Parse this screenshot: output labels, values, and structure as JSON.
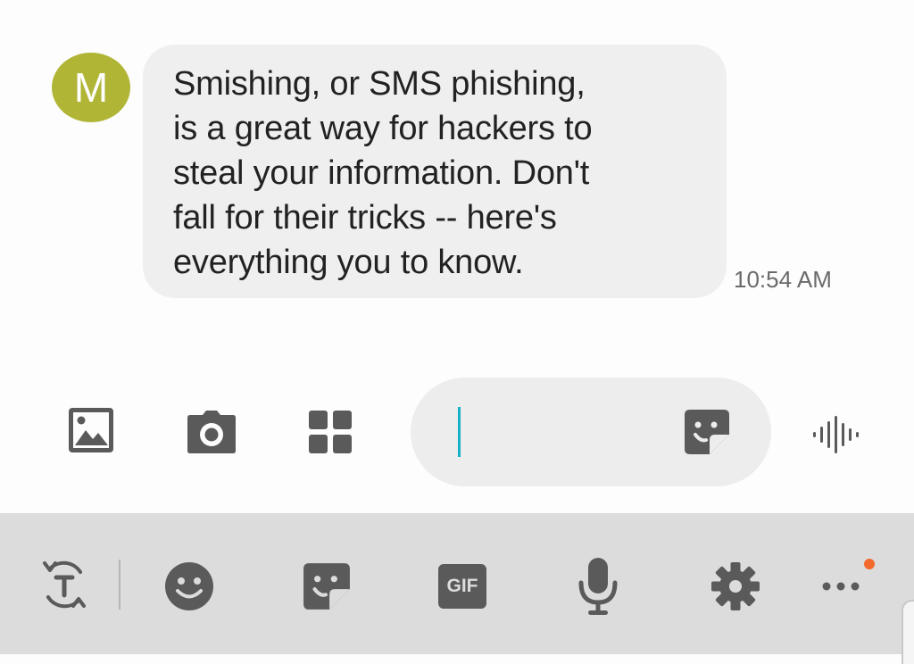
{
  "conversation": {
    "sender_initial": "M",
    "message_lines": [
      "Smishing, or SMS phishing,",
      "is a great way for hackers to",
      "steal your information. Don't",
      "fall for their tricks -- here's",
      "everything you to know."
    ],
    "timestamp": "10:54 AM"
  },
  "composer": {
    "input_value": "",
    "buttons": {
      "gallery": "image-icon",
      "camera": "camera-icon",
      "apps": "grid-icon",
      "sticker": "sticker-icon",
      "voice": "voice-wave-icon"
    }
  },
  "keyboard_toolbar": {
    "gif_label": "GIF",
    "icons": [
      "translate-icon",
      "emoji-icon",
      "sticker-icon",
      "gif-icon",
      "microphone-icon",
      "settings-icon",
      "more-icon"
    ],
    "notification_dot_color": "#f26a2c"
  },
  "colors": {
    "avatar": "#b1b536",
    "bubble": "#efefef",
    "cursor": "#16b2c8",
    "toolbar": "#dcdcdc"
  }
}
